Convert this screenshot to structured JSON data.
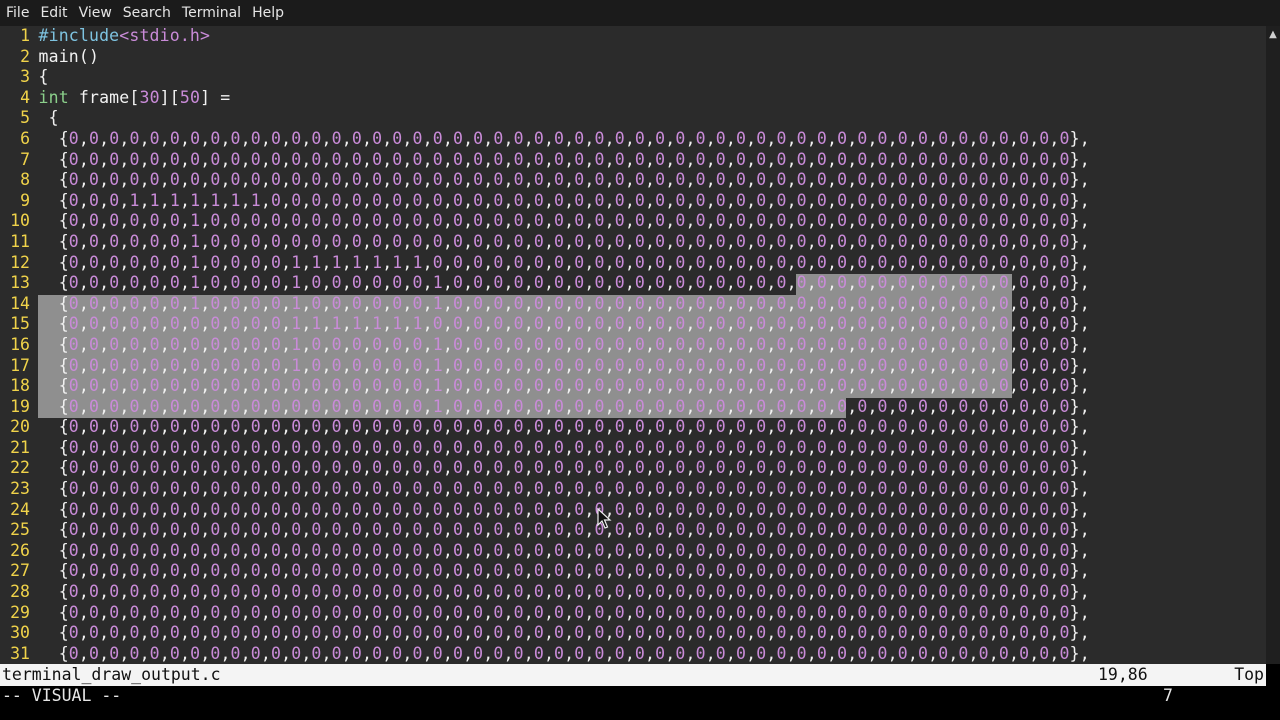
{
  "menubar": {
    "items": [
      {
        "label": "File"
      },
      {
        "label": "Edit"
      },
      {
        "label": "View"
      },
      {
        "label": "Search"
      },
      {
        "label": "Terminal"
      },
      {
        "label": "Help"
      }
    ]
  },
  "editor": {
    "line_numbers": [
      "1",
      "2",
      "3",
      "4",
      "5",
      "6",
      "7",
      "8",
      "9",
      "10",
      "11",
      "12",
      "13",
      "14",
      "15",
      "16",
      "17",
      "18",
      "19",
      "20",
      "21",
      "22",
      "23",
      "24",
      "25",
      "26",
      "27",
      "28",
      "29",
      "30",
      "31"
    ],
    "lines": [
      "#include<stdio.h>",
      "main()",
      "{",
      "int frame[30][50] =",
      " {",
      "  {0,0,0,0,0,0,0,0,0,0,0,0,0,0,0,0,0,0,0,0,0,0,0,0,0,0,0,0,0,0,0,0,0,0,0,0,0,0,0,0,0,0,0,0,0,0,0,0,0,0},",
      "  {0,0,0,0,0,0,0,0,0,0,0,0,0,0,0,0,0,0,0,0,0,0,0,0,0,0,0,0,0,0,0,0,0,0,0,0,0,0,0,0,0,0,0,0,0,0,0,0,0,0},",
      "  {0,0,0,0,0,0,0,0,0,0,0,0,0,0,0,0,0,0,0,0,0,0,0,0,0,0,0,0,0,0,0,0,0,0,0,0,0,0,0,0,0,0,0,0,0,0,0,0,0,0},",
      "  {0,0,0,1,1,1,1,1,1,1,0,0,0,0,0,0,0,0,0,0,0,0,0,0,0,0,0,0,0,0,0,0,0,0,0,0,0,0,0,0,0,0,0,0,0,0,0,0,0,0},",
      "  {0,0,0,0,0,0,1,0,0,0,0,0,0,0,0,0,0,0,0,0,0,0,0,0,0,0,0,0,0,0,0,0,0,0,0,0,0,0,0,0,0,0,0,0,0,0,0,0,0,0},",
      "  {0,0,0,0,0,0,1,0,0,0,0,0,0,0,0,0,0,0,0,0,0,0,0,0,0,0,0,0,0,0,0,0,0,0,0,0,0,0,0,0,0,0,0,0,0,0,0,0,0,0},",
      "  {0,0,0,0,0,0,1,0,0,0,0,1,1,1,1,1,1,1,0,0,0,0,0,0,0,0,0,0,0,0,0,0,0,0,0,0,0,0,0,0,0,0,0,0,0,0,0,0,0,0},",
      "  {0,0,0,0,0,0,1,0,0,0,0,1,0,0,0,0,0,0,1,0,0,0,0,0,0,0,0,0,0,0,0,0,0,0,0,0,0,0,0,0,0,0,0,0,0,0,0,0,0,0},",
      "  {0,0,0,0,0,0,1,0,0,0,0,1,0,0,0,0,0,0,1,0,0,0,0,0,0,0,0,0,0,0,0,0,0,0,0,0,0,0,0,0,0,0,0,0,0,0,0,0,0,0},",
      "  {0,0,0,0,0,0,0,0,0,0,0,1,1,1,1,1,1,1,0,0,0,0,0,0,0,0,0,0,0,0,0,0,0,0,0,0,0,0,0,0,0,0,0,0,0,0,0,0,0,0},",
      "  {0,0,0,0,0,0,0,0,0,0,0,1,0,0,0,0,0,0,1,0,0,0,0,0,0,0,0,0,0,0,0,0,0,0,0,0,0,0,0,0,0,0,0,0,0,0,0,0,0,0},",
      "  {0,0,0,0,0,0,0,0,0,0,0,1,0,0,0,0,0,0,1,0,0,0,0,0,0,0,0,0,0,0,0,0,0,0,0,0,0,0,0,0,0,0,0,0,0,0,0,0,0,0},",
      "  {0,0,0,0,0,0,0,0,0,0,0,0,0,0,0,0,0,0,1,0,0,0,0,0,0,0,0,0,0,0,0,0,0,0,0,0,0,0,0,0,0,0,0,0,0,0,0,0,0,0},",
      "  {0,0,0,0,0,0,0,0,0,0,0,0,0,0,0,0,0,0,1,0,0,0,0,0,0,0,0,0,0,0,0,0,0,0,0,0,0,0,0,0,0,0,0,0,0,0,0,0,0,0},",
      "  {0,0,0,0,0,0,0,0,0,0,0,0,0,0,0,0,0,0,0,0,0,0,0,0,0,0,0,0,0,0,0,0,0,0,0,0,0,0,0,0,0,0,0,0,0,0,0,0,0,0},",
      "  {0,0,0,0,0,0,0,0,0,0,0,0,0,0,0,0,0,0,0,0,0,0,0,0,0,0,0,0,0,0,0,0,0,0,0,0,0,0,0,0,0,0,0,0,0,0,0,0,0,0},",
      "  {0,0,0,0,0,0,0,0,0,0,0,0,0,0,0,0,0,0,0,0,0,0,0,0,0,0,0,0,0,0,0,0,0,0,0,0,0,0,0,0,0,0,0,0,0,0,0,0,0,0},",
      "  {0,0,0,0,0,0,0,0,0,0,0,0,0,0,0,0,0,0,0,0,0,0,0,0,0,0,0,0,0,0,0,0,0,0,0,0,0,0,0,0,0,0,0,0,0,0,0,0,0,0},",
      "  {0,0,0,0,0,0,0,0,0,0,0,0,0,0,0,0,0,0,0,0,0,0,0,0,0,0,0,0,0,0,0,0,0,0,0,0,0,0,0,0,0,0,0,0,0,0,0,0,0,0},",
      "  {0,0,0,0,0,0,0,0,0,0,0,0,0,0,0,0,0,0,0,0,0,0,0,0,0,0,0,0,0,0,0,0,0,0,0,0,0,0,0,0,0,0,0,0,0,0,0,0,0,0},",
      "  {0,0,0,0,0,0,0,0,0,0,0,0,0,0,0,0,0,0,0,0,0,0,0,0,0,0,0,0,0,0,0,0,0,0,0,0,0,0,0,0,0,0,0,0,0,0,0,0,0,0},",
      "  {0,0,0,0,0,0,0,0,0,0,0,0,0,0,0,0,0,0,0,0,0,0,0,0,0,0,0,0,0,0,0,0,0,0,0,0,0,0,0,0,0,0,0,0,0,0,0,0,0,0},",
      "  {0,0,0,0,0,0,0,0,0,0,0,0,0,0,0,0,0,0,0,0,0,0,0,0,0,0,0,0,0,0,0,0,0,0,0,0,0,0,0,0,0,0,0,0,0,0,0,0,0,0},",
      "  {0,0,0,0,0,0,0,0,0,0,0,0,0,0,0,0,0,0,0,0,0,0,0,0,0,0,0,0,0,0,0,0,0,0,0,0,0,0,0,0,0,0,0,0,0,0,0,0,0,0},",
      "  {0,0,0,0,0,0,0,0,0,0,0,0,0,0,0,0,0,0,0,0,0,0,0,0,0,0,0,0,0,0,0,0,0,0,0,0,0,0,0,0,0,0,0,0,0,0,0,0,0,0},",
      "  {0,0,0,0,0,0,0,0,0,0,0,0,0,0,0,0,0,0,0,0,0,0,0,0,0,0,0,0,0,0,0,0,0,0,0,0,0,0,0,0,0,0,0,0,0,0,0,0,0,0},"
    ],
    "colors": {
      "background": "#2b2b2b",
      "line_number": "#f0d34a",
      "preprocessor": "#7ec3e0",
      "string": "#c98bd8",
      "type_keyword": "#8bd08b",
      "number": "#c98bd8",
      "selection": "#8f8f8f"
    }
  },
  "statusline": {
    "filename": "terminal_draw_output.c",
    "position": "19,86",
    "scroll": "Top"
  },
  "cmdline": {
    "mode": "-- VISUAL --",
    "selected_count": "7"
  },
  "icons": {
    "scroll_up": "scroll-up-arrow-icon",
    "mouse_cursor": "mouse-pointer-icon"
  }
}
